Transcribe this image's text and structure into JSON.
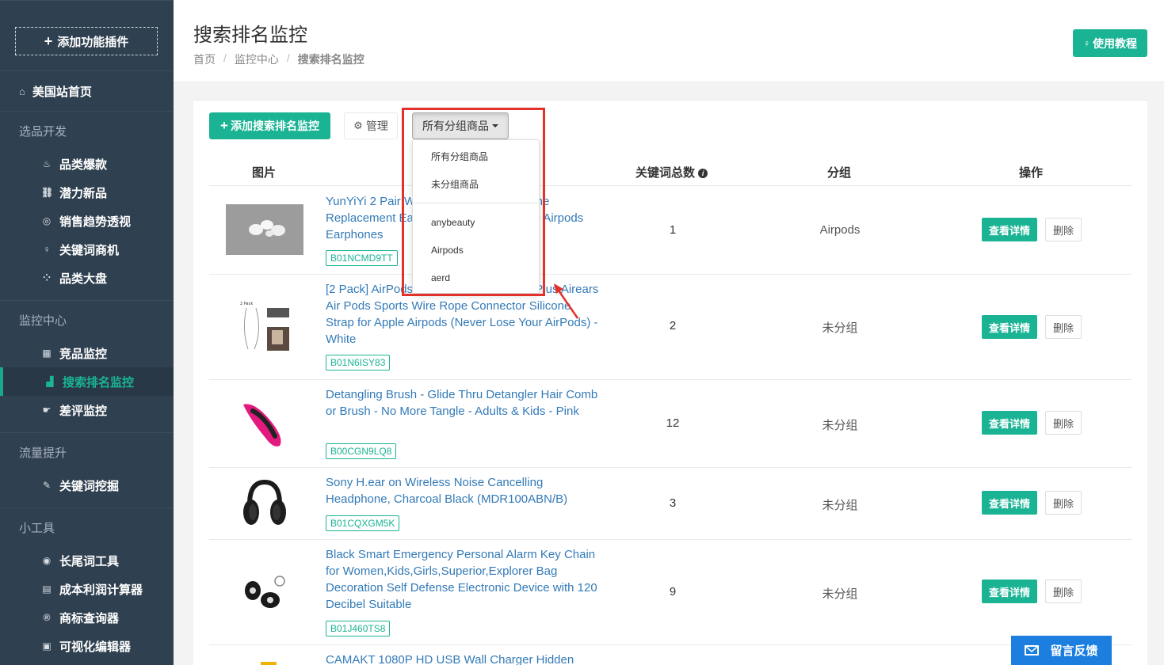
{
  "sidebar": {
    "add_plugin": "添加功能插件",
    "home": "美国站首页",
    "sections": [
      {
        "title": "选品开发",
        "items": [
          {
            "label": "品类爆款",
            "icon": "flame-icon"
          },
          {
            "label": "潜力新品",
            "icon": "link-icon"
          },
          {
            "label": "销售趋势透视",
            "icon": "globe-icon"
          },
          {
            "label": "关键词商机",
            "icon": "bulb-icon"
          },
          {
            "label": "品类大盘",
            "icon": "grid-icon"
          }
        ]
      },
      {
        "title": "监控中心",
        "items": [
          {
            "label": "竞品监控",
            "icon": "table-icon"
          },
          {
            "label": "搜索排名监控",
            "icon": "bar-chart-icon",
            "active": true
          },
          {
            "label": "差评监控",
            "icon": "thumbs-down-icon"
          }
        ]
      },
      {
        "title": "流量提升",
        "items": [
          {
            "label": "关键词挖掘",
            "icon": "edit-icon"
          }
        ]
      },
      {
        "title": "小工具",
        "items": [
          {
            "label": "长尾词工具",
            "icon": "circle-icon"
          },
          {
            "label": "成本利润计算器",
            "icon": "calculator-icon"
          },
          {
            "label": "商标查询器",
            "icon": "registered-icon"
          },
          {
            "label": "可视化编辑器",
            "icon": "image-icon"
          }
        ]
      }
    ]
  },
  "header": {
    "title": "搜索排名监控",
    "breadcrumb": [
      "首页",
      "监控中心",
      "搜索排名监控"
    ],
    "breadcrumb_sep": "/",
    "tutorial_button": "使用教程"
  },
  "toolbar": {
    "add_button": "添加搜索排名监控",
    "manage_button": "管理",
    "group_select": "所有分组商品"
  },
  "table": {
    "columns": [
      "图片",
      "关键词总数",
      "分组",
      "操作"
    ],
    "rows": [
      {
        "title": "YunYiYi 2 Pair Wireless Earphone Silicone Replacement Earbuds Ear Tips for Apple Airpods Earphones",
        "asin": "B01NCMD9TT",
        "count": "1",
        "group": "Airpods"
      },
      {
        "title": "[2 Pack] AirPods Strap, for iPhone 7 / 7 Plus Airears Air Pods Sports Wire Rope Connector Silicone Strap for Apple Airpods (Never Lose Your AirPods) - White",
        "asin": "B01N6ISY83",
        "count": "2",
        "group": "未分组"
      },
      {
        "title": "Detangling Brush - Glide Thru Detangler Hair Comb or Brush - No More Tangle - Adults & Kids - Pink",
        "asin": "B00CGN9LQ8",
        "count": "12",
        "group": "未分组"
      },
      {
        "title": "Sony H.ear on Wireless Noise Cancelling Headphone, Charcoal Black (MDR100ABN/B)",
        "asin": "B01CQXGM5K",
        "count": "3",
        "group": "未分组"
      },
      {
        "title": "Black Smart Emergency Personal Alarm Key Chain for Women,Kids,Girls,Superior,Explorer Bag Decoration Self Defense Electronic Device with 120 Decibel Suitable",
        "asin": "B01J460TS8",
        "count": "9",
        "group": "未分组"
      },
      {
        "title": "CAMAKT 1080P HD USB Wall Charger Hidden",
        "asin": "",
        "count": "",
        "group": ""
      }
    ],
    "detail_button": "查看详情",
    "delete_button": "删除"
  },
  "dropdown": {
    "items": [
      "所有分组商品",
      "未分组商品"
    ],
    "groups": [
      "anybeauty",
      "Airpods",
      "aerd"
    ]
  },
  "feedback": "留言反馈",
  "colors": {
    "accent": "#1ab394",
    "sidebar": "#2f4050",
    "highlight": "#e3312b",
    "link": "#337ab7"
  }
}
